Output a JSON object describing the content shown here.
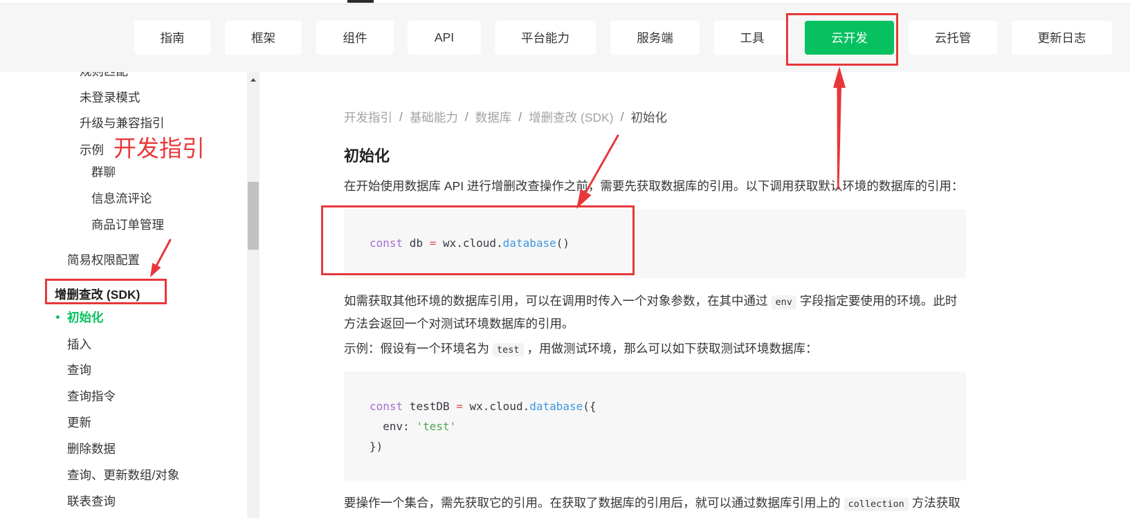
{
  "colors": {
    "brand_green": "#07c160",
    "annotation_red": "#e8373a",
    "nav_background": "#f6f6f6",
    "code_keyword": "#a66bd3",
    "code_operator": "#e0575b",
    "code_function": "#3f97e0",
    "code_string": "#4fa54f"
  },
  "nav": {
    "items": [
      "指南",
      "框架",
      "组件",
      "API",
      "平台能力",
      "服务端",
      "工具",
      "云开发",
      "云托管",
      "更新日志"
    ]
  },
  "sidebar": {
    "items": [
      "规则匹配",
      "未登录模式",
      "升级与兼容指引",
      "示例",
      "群聊",
      "信息流评论",
      "商品订单管理",
      "简易权限配置",
      "增删查改 (SDK)",
      "初始化",
      "插入",
      "查询",
      "查询指令",
      "更新",
      "删除数据",
      "查询、更新数组/对象",
      "联表查询"
    ]
  },
  "annotation": {
    "text": "开发指引"
  },
  "breadcrumb": {
    "items": [
      "开发指引",
      "基础能力",
      "数据库",
      "增删查改 (SDK)",
      "初始化"
    ],
    "separator": "/"
  },
  "content": {
    "title": "初始化",
    "intro": "在开始使用数据库 API 进行增删改查操作之前，需要先获取数据库的引用。以下调用获取默认环境的数据库的引用：",
    "code_default": {
      "lines": [
        [
          "const",
          " db ",
          "=",
          " wx.cloud.",
          "database",
          "()"
        ]
      ]
    },
    "env_paragraph": {
      "before": "如需获取其他环境的数据库引用，可以在调用时传入一个对象参数，在其中通过",
      "code": "env",
      "after": "字段指定要使用的环境。此时方法会返回一个对测试环境数据库的引用。"
    },
    "example_paragraph": {
      "before": "示例：假设有一个环境名为",
      "code": "test",
      "after": "，用做测试环境，那么可以如下获取测试环境数据库："
    },
    "code_test": {
      "lines": [
        [
          "const",
          " testDB ",
          "=",
          " wx.cloud.",
          "database",
          "({"
        ],
        [
          "  env: ",
          "'test'"
        ],
        [
          "})"
        ]
      ]
    },
    "collection_paragraph": {
      "before": "要操作一个集合，需先获取它的引用。在获取了数据库的引用后，就可以通过数据库引用上的",
      "code": "collection",
      "after": "方法获取"
    }
  }
}
